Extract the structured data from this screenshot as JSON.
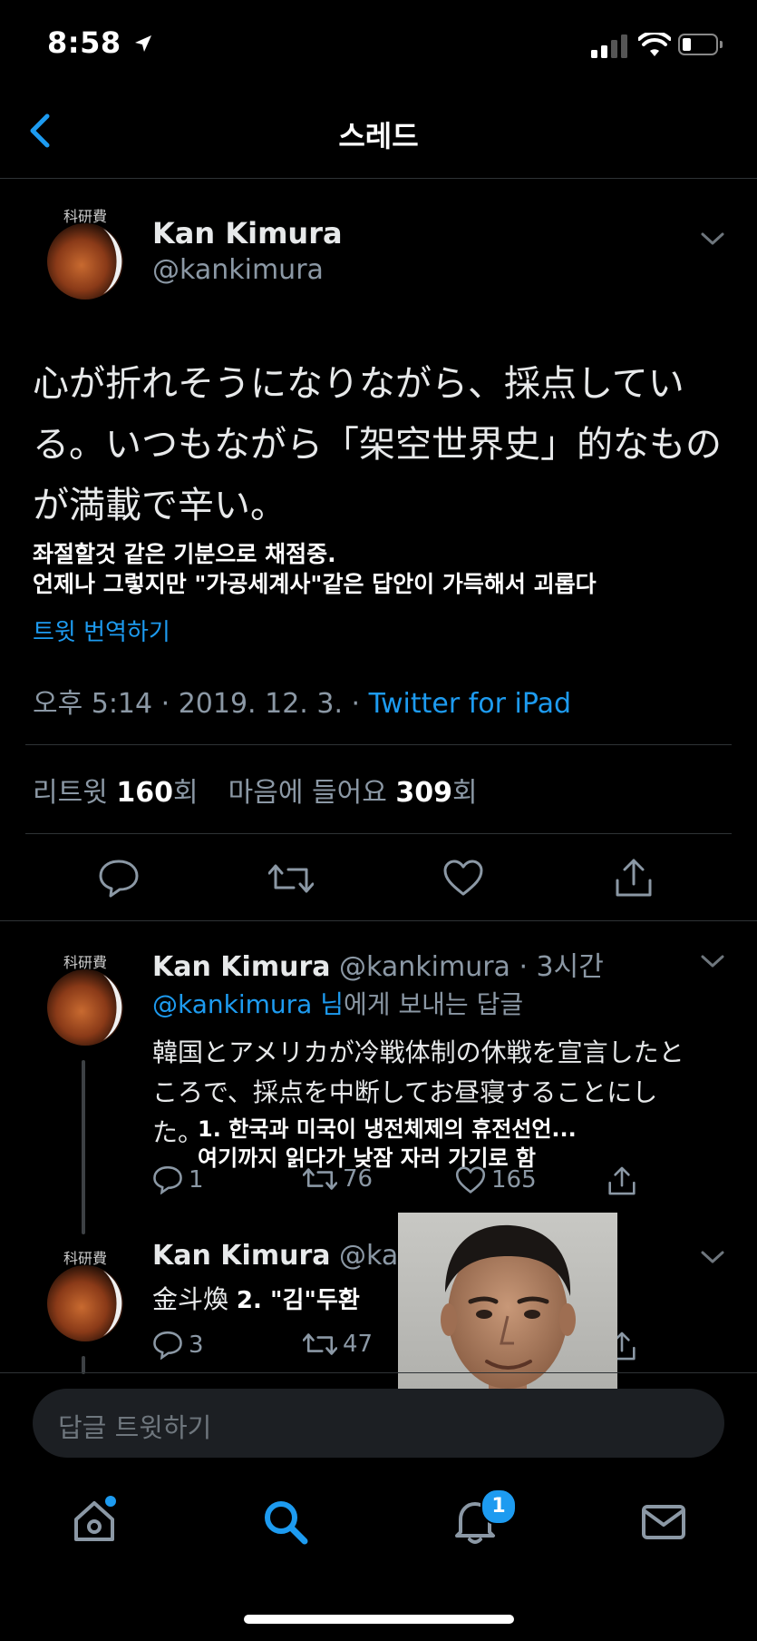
{
  "status_bar": {
    "time": "8:58"
  },
  "nav": {
    "title": "스레드"
  },
  "main_tweet": {
    "name": "Kan Kimura",
    "handle": "@kankimura",
    "text_line1": "心が折れそうになりながら、採点してい",
    "text_line2": "る。いつもながら「架空世界史」的なもの",
    "text_line3": "が満載で辛い。",
    "caption_line1": "좌절할것 같은 기분으로 채점중.",
    "caption_line2": "언제나 그렇지만 \"가공세계사\"같은 답안이 가득해서 괴롭다",
    "translate": "트윗 번역하기",
    "timestamp": "오후 5:14 · 2019. 12. 3. · ",
    "source": "Twitter for iPad",
    "retweets_label": "리트윗 ",
    "retweets_count": "160",
    "retweets_unit": "회",
    "likes_label": "마음에 들어요 ",
    "likes_count": "309",
    "likes_unit": "회"
  },
  "reply1": {
    "name": "Kan Kimura",
    "handle_time": "@kankimura · 3시간",
    "reply_to_handle": "@kankimura 님",
    "reply_to_suffix": "에게 보내는 답글",
    "text_line1": "韓国とアメリカが冷戦体制の休戦を宣言したと",
    "text_line2": "ころで、採点を中断してお昼寝することにし",
    "text_line3": "た。",
    "caption_line1": "1. 한국과 미국이 냉전체제의 휴전선언...",
    "caption_line2": "여기까지 읽다가 낮잠 자러 가기로 함",
    "replies": "1",
    "retweets": "76",
    "likes": "165"
  },
  "reply2": {
    "name": "Kan Kimura",
    "handle_time": "@kan",
    "text": "金斗煥",
    "caption": "2. \"김\"두환",
    "replies": "3",
    "retweets": "47"
  },
  "composer": {
    "placeholder": "답글 트윗하기"
  },
  "tabbar": {
    "notifications_badge": "1"
  },
  "colors": {
    "accent": "#1d9bf0",
    "background": "#000000",
    "muted": "#8b98a5"
  }
}
